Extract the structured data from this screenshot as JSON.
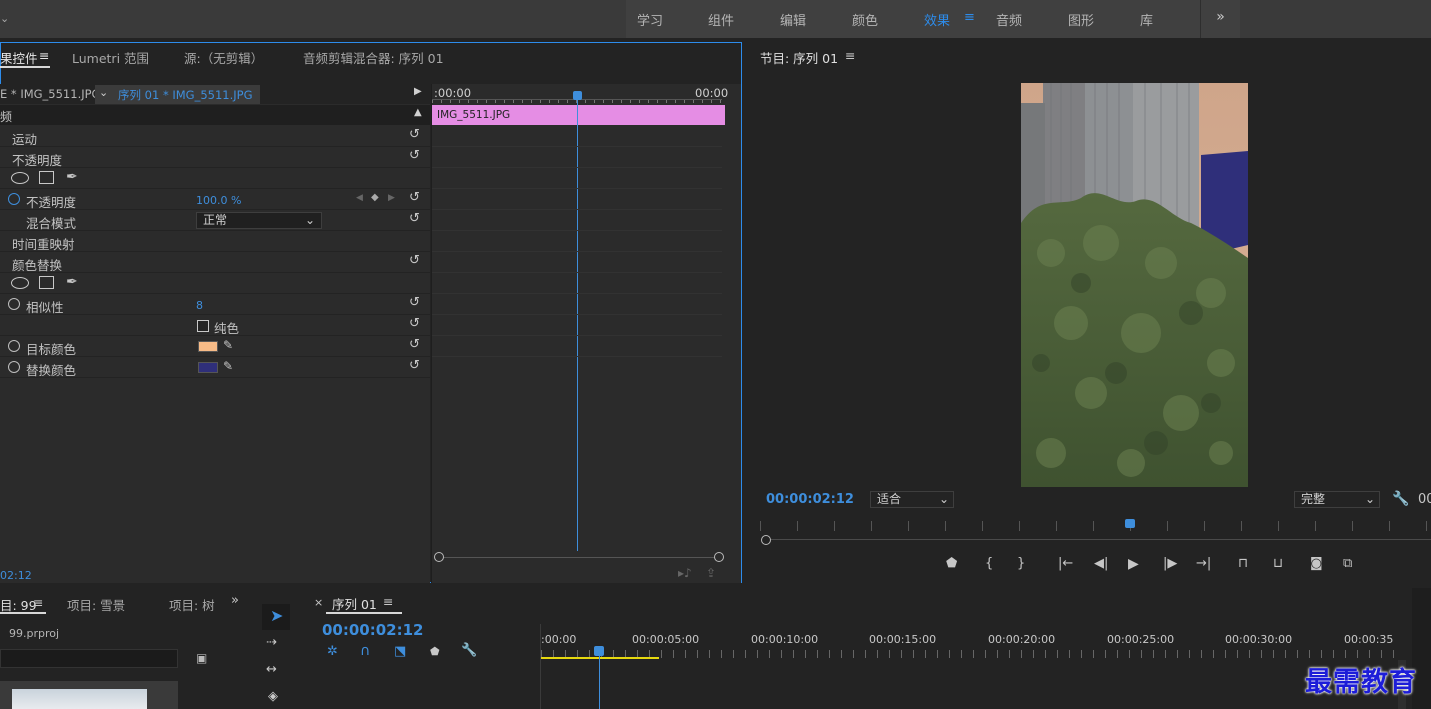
{
  "workspaces": {
    "items": [
      "学习",
      "组件",
      "编辑",
      "颜色",
      "效果",
      "音频",
      "图形",
      "库"
    ],
    "active": "效果",
    "menu_icon": "≡",
    "more": "»"
  },
  "effect_controls": {
    "tabs": [
      "果控件",
      "Lumetri 范围",
      "源:（无剪辑）",
      "音频剪辑混合器: 序列 01"
    ],
    "tab_menu": "≡",
    "master_clip": "E * IMG_5511.JPG",
    "sequence_clip": "序列 01 * IMG_5511.JPG",
    "video_header": "频",
    "timeline_start": ":00:00",
    "timeline_end": "00:00",
    "clip_bar_label": "IMG_5511.JPG",
    "clip_bar_color": "#e58de4",
    "motion_label": "运动",
    "opacity_group": "不透明度",
    "opacity_label": "不透明度",
    "opacity_value": "100.0 %",
    "blend_label": "混合模式",
    "blend_value": "正常",
    "time_remap_label": "时间重映射",
    "color_replace_label": "颜色替换",
    "similarity_label": "相似性",
    "similarity_value": "8",
    "solid_color_label": "纯色",
    "target_color_label": "目标颜色",
    "target_color": "#f7bb87",
    "replace_color_label": "替换颜色",
    "replace_color": "#2f2f7a",
    "timecode": "02:12"
  },
  "program_monitor": {
    "title": "节目: 序列 01",
    "menu": "≡",
    "timecode": "00:00:02:12",
    "fit_value": "适合",
    "quality_value": "完整",
    "right_clip": "00"
  },
  "project": {
    "tab_active": "目: 99",
    "tab_menu": "≡",
    "tab2": "项目: 雪景",
    "tab3": "项目: 树",
    "more": "»",
    "file_name": "99.prproj"
  },
  "sequence": {
    "close": "×",
    "title": "序列 01",
    "menu": "≡",
    "timecode": "00:00:02:12",
    "ruler": [
      ":00:00",
      "00:00:05:00",
      "00:00:10:00",
      "00:00:15:00",
      "00:00:20:00",
      "00:00:25:00",
      "00:00:30:00",
      "00:00:35"
    ]
  },
  "watermark": "最需教育"
}
